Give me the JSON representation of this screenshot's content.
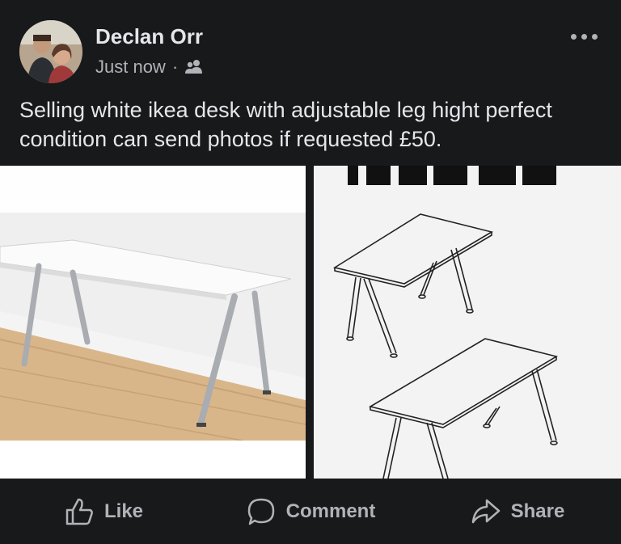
{
  "post": {
    "author": "Declan Orr",
    "timestamp": "Just now",
    "separator": "·",
    "audience_icon": "friends-icon",
    "more_icon": "more-options-icon",
    "body": "Selling white ikea desk with adjustable leg hight perfect condition can send photos if requested £50."
  },
  "photos": {
    "left": "desk-photo",
    "right": "desk-diagram",
    "right_heading_fragment": "THYGE"
  },
  "actions": {
    "like": "Like",
    "comment": "Comment",
    "share": "Share"
  }
}
